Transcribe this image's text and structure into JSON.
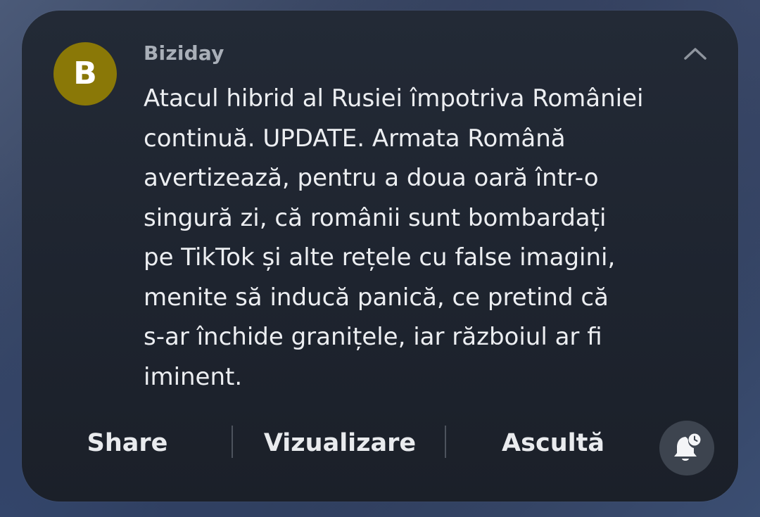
{
  "notification": {
    "avatar_letter": "B",
    "avatar_color": "#8a7807",
    "app_name": "Biziday",
    "message_lines": [
      "Atacul hibrid al Rusiei împotriva României",
      "continuă. UPDATE. Armata Română",
      "avertizează, pentru a doua oară într-o",
      "singură zi, că românii sunt bombardați",
      "pe TikTok și alte rețele cu false imagini,",
      "menite să inducă panică, ce pretind că",
      "s-ar închide granițele, iar războiul ar fi",
      "iminent."
    ],
    "collapse_icon": "chevron-up-icon",
    "actions": {
      "share_label": "Share",
      "view_label": "Vizualizare",
      "listen_label": "Ascultă"
    },
    "snooze_icon": "bell-snooze-icon"
  }
}
